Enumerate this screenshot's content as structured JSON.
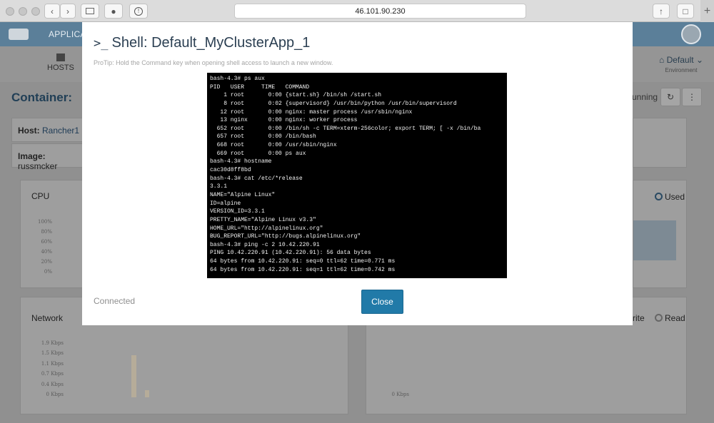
{
  "browser": {
    "address": "46.101.90.230",
    "back_icon": "chevron-left-icon",
    "forward_icon": "chevron-right-icon",
    "new_tab_label": "+"
  },
  "app": {
    "nav_label": "APPLICAT",
    "hosts_label": "HOSTS",
    "environment": {
      "name": "Default",
      "label": "Environment"
    },
    "container_label": "Container:",
    "running_text": "unning",
    "host": {
      "label": "Host:",
      "value": "Rancher1"
    },
    "image": {
      "label": "Image:",
      "value": "russmcker"
    },
    "cpu": {
      "title": "CPU",
      "used_label": "Used",
      "ticks": [
        "100%",
        "80%",
        "60%",
        "40%",
        "20%",
        "0%"
      ]
    },
    "network": {
      "title": "Network",
      "ticks": [
        "1.9 Kbps",
        "1.5 Kbps",
        "1.1 Kbps",
        "0.7 Kbps",
        "0.4 Kbps",
        "0 Kbps"
      ],
      "bars": [
        0.82,
        0.14
      ]
    },
    "disk": {
      "write_label": "rite",
      "read_label": "Read",
      "tick": "0 Kbps"
    }
  },
  "modal": {
    "title": "Shell: Default_MyClusterApp_1",
    "prompt_glyph": ">_",
    "protip": "ProTip: Hold the Command key when opening shell access to launch a new window.",
    "terminal_lines": [
      "bash-4.3# ps aux",
      "PID   USER     TIME   COMMAND",
      "    1 root       0:00 {start.sh} /bin/sh /start.sh",
      "    8 root       0:02 {supervisord} /usr/bin/python /usr/bin/supervisord",
      "   12 root       0:00 nginx: master process /usr/sbin/nginx",
      "   13 nginx      0:00 nginx: worker process",
      "  652 root       0:00 /bin/sh -c TERM=xterm-256color; export TERM; [ -x /bin/ba",
      "  657 root       0:00 /bin/bash",
      "  668 root       0:00 /usr/sbin/nginx",
      "  669 root       0:00 ps aux",
      "bash-4.3# hostname",
      "cac30d8ff8bd",
      "bash-4.3# cat /etc/*release",
      "3.3.1",
      "NAME=\"Alpine Linux\"",
      "ID=alpine",
      "VERSION_ID=3.3.1",
      "PRETTY_NAME=\"Alpine Linux v3.3\"",
      "HOME_URL=\"http://alpinelinux.org\"",
      "BUG_REPORT_URL=\"http://bugs.alpinelinux.org\"",
      "bash-4.3# ping -c 2 10.42.220.91",
      "PING 10.42.220.91 (10.42.220.91): 56 data bytes",
      "64 bytes from 10.42.220.91: seq=0 ttl=62 time=0.771 ms",
      "64 bytes from 10.42.220.91: seq=1 ttl=62 time=0.742 ms"
    ],
    "status": "Connected",
    "close_label": "Close"
  }
}
